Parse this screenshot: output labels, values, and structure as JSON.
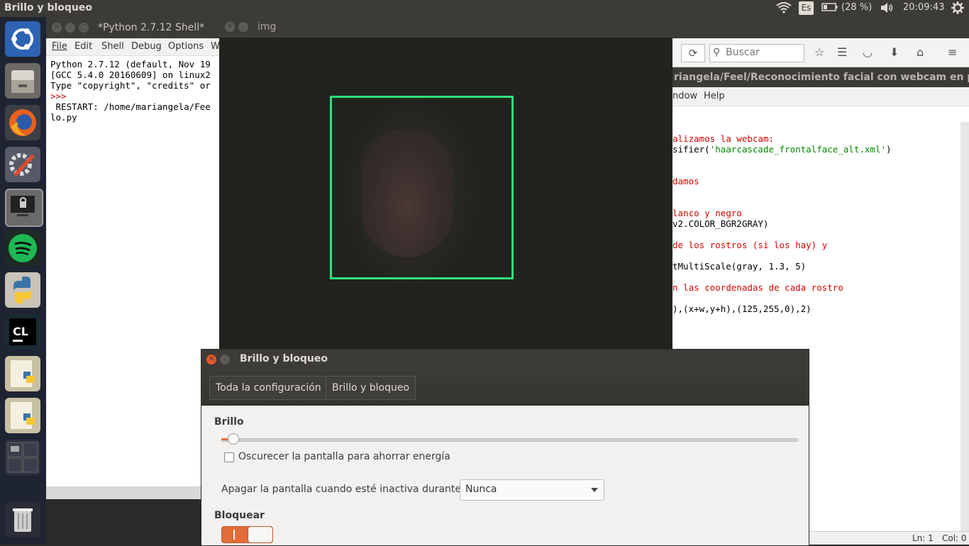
{
  "top_panel": {
    "title": "Brillo y bloqueo",
    "keyboard": "Es",
    "battery": "(28 %)",
    "time": "20:09:43"
  },
  "launcher": {
    "items": [
      "ubuntu-icon",
      "files-icon",
      "firefox-icon",
      "system-settings-icon",
      "lock-screen-icon",
      "spotify-icon",
      "python-icon",
      "clion-icon",
      "python-file-icon",
      "python-file-icon",
      "workspace-switcher-icon",
      "trash-icon"
    ]
  },
  "idle": {
    "title": "*Python 2.7.12 Shell*",
    "menu": [
      "File",
      "Edit",
      "Shell",
      "Debug",
      "Options",
      "W"
    ],
    "lines": [
      "Python 2.7.12 (default, Nov 19",
      "[GCC 5.4.0 20160609] on linux2",
      "Type \"copyright\", \"credits\" or",
      ">>>",
      " RESTART: /home/mariangela/Fee",
      "lo.py"
    ]
  },
  "imgwin": {
    "title": "img"
  },
  "editor": {
    "search_placeholder": "Buscar",
    "path": "riangela/Feel/Reconocimiento facial con webcam en pyth",
    "menu": [
      "ndow",
      "Help"
    ],
    "code": [
      {
        "t": "alizamos la webcam:",
        "k": "c"
      },
      {
        "t": "sifier(",
        "k": "n",
        "s": "'haarcascade_frontalface_alt.xml'",
        "e": ")"
      },
      {
        "t": "",
        "k": "n"
      },
      {
        "t": "",
        "k": "n"
      },
      {
        "t": "damos",
        "k": "c"
      },
      {
        "t": "",
        "k": "n"
      },
      {
        "t": "",
        "k": "n"
      },
      {
        "t": "lanco y negro",
        "k": "c"
      },
      {
        "t": "v2.COLOR_BGR2GRAY)",
        "k": "n"
      },
      {
        "t": "",
        "k": "n"
      },
      {
        "t": "de los rostros (si los hay) y",
        "k": "c"
      },
      {
        "t": "",
        "k": "n"
      },
      {
        "t": "tMultiScale(gray, 1.3, 5)",
        "k": "n"
      },
      {
        "t": "",
        "k": "n"
      },
      {
        "t": "n las coordenadas de cada rostro",
        "k": "c"
      },
      {
        "t": "",
        "k": "n"
      },
      {
        "t": "),(x+w,y+h),(125,255,0),2)",
        "k": "n"
      }
    ],
    "status_ln": "Ln: 1",
    "status_col": "Col: 0"
  },
  "settings": {
    "title": "Brillo y bloqueo",
    "crumbs": [
      "Toda la configuración",
      "Brillo y bloqueo"
    ],
    "brightness_label": "Brillo",
    "brightness_level": 0.02,
    "dim_label": "Oscurecer la pantalla para ahorrar energía",
    "dim_checked": false,
    "off_label": "Apagar la pantalla cuando esté inactiva durante:",
    "off_value": "Nunca",
    "lock_label": "Bloquear",
    "lock_on": true
  },
  "colors": {
    "accent": "#e36d3a",
    "facebox": "#2ee57a"
  }
}
